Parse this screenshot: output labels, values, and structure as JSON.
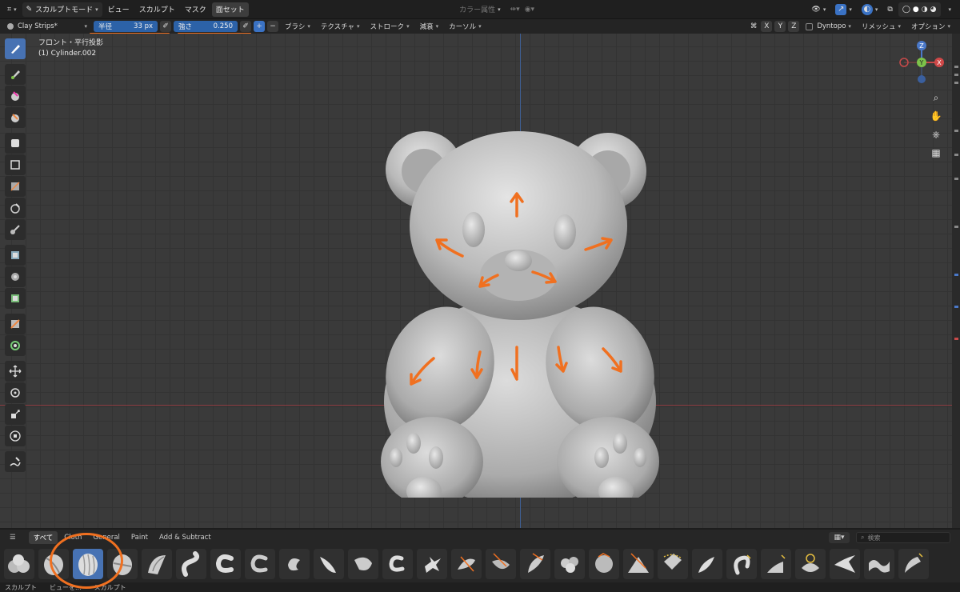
{
  "topbar": {
    "mode_label": "スカルプトモード",
    "menus": [
      "ビュー",
      "スカルプト",
      "マスク",
      "面セット"
    ],
    "color_attr": "カラー属性"
  },
  "toolheader": {
    "brush_name": "Clay Strips*",
    "radius_label": "半径",
    "radius_value": "33 px",
    "strength_label": "強さ",
    "strength_value": "0.250",
    "plus": "+",
    "minus": "−",
    "dropdowns": [
      "ブラシ",
      "テクスチャ",
      "ストローク",
      "減衰",
      "カーソル"
    ],
    "axes": [
      "X",
      "Y",
      "Z"
    ],
    "dyntopo": "Dyntopo",
    "remesh": "リメッシュ",
    "options": "オプション"
  },
  "viewport": {
    "view_name": "フロント・平行投影",
    "object_name": "(1) Cylinder.002"
  },
  "gizmo": {
    "z": "Z",
    "y": "Y",
    "x": "X"
  },
  "shelf": {
    "tabs": [
      "すべて",
      "Cloth",
      "General",
      "Paint",
      "Add & Subtract"
    ],
    "search_placeholder": "検索"
  },
  "statusbar": {
    "items": [
      "スカルプト",
      "ビューを...",
      "スカルプト"
    ]
  },
  "colors": {
    "accent": "#4772b3",
    "annotation": "#f07020",
    "axis_x": "#8a3a3e",
    "axis_y": "#3f5f92"
  }
}
